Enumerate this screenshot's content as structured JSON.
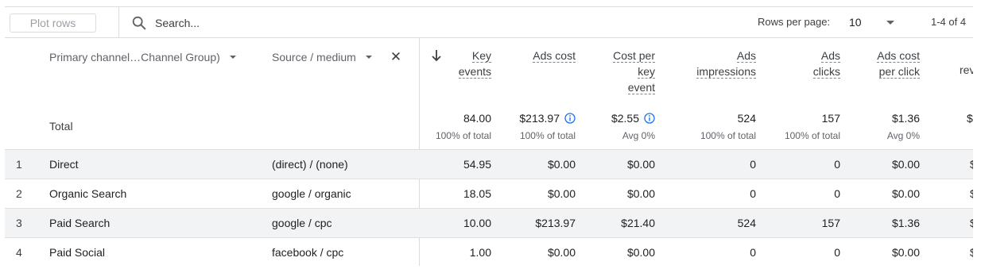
{
  "toolbar": {
    "plot_rows_label": "Plot rows",
    "search_placeholder": "Search...",
    "rows_per_page_label": "Rows per page:",
    "rows_per_page_value": "10",
    "pagination": "1-4 of 4"
  },
  "dimensions": {
    "primary": "Primary channel…Channel Group)",
    "secondary": "Source / medium"
  },
  "metrics": [
    {
      "label_lines": [
        "Key",
        "events"
      ],
      "total": "84.00",
      "total_sub": "100% of total",
      "info": false
    },
    {
      "label_lines": [
        "Ads cost"
      ],
      "total": "$213.97",
      "total_sub": "100% of total",
      "info": true
    },
    {
      "label_lines": [
        "Cost per",
        "key",
        "event"
      ],
      "total": "$2.55",
      "total_sub": "Avg 0%",
      "info": true
    },
    {
      "label_lines": [
        "Ads",
        "impressions"
      ],
      "total": "524",
      "total_sub": "100% of total",
      "info": false
    },
    {
      "label_lines": [
        "Ads",
        "clicks"
      ],
      "total": "157",
      "total_sub": "100% of total",
      "info": false
    },
    {
      "label_lines": [
        "Ads cost",
        "per click"
      ],
      "total": "$1.36",
      "total_sub": "Avg 0%",
      "info": false
    }
  ],
  "cut_column": {
    "label": "rev",
    "total": "$",
    "cell": "$"
  },
  "total_label": "Total",
  "rows": [
    {
      "rank": "1",
      "channel": "Direct",
      "source": "(direct) / (none)",
      "values": [
        "54.95",
        "$0.00",
        "$0.00",
        "0",
        "0",
        "$0.00"
      ]
    },
    {
      "rank": "2",
      "channel": "Organic Search",
      "source": "google / organic",
      "values": [
        "18.05",
        "$0.00",
        "$0.00",
        "0",
        "0",
        "$0.00"
      ]
    },
    {
      "rank": "3",
      "channel": "Paid Search",
      "source": "google / cpc",
      "values": [
        "10.00",
        "$213.97",
        "$21.40",
        "524",
        "157",
        "$1.36"
      ]
    },
    {
      "rank": "4",
      "channel": "Paid Social",
      "source": "facebook / cpc",
      "values": [
        "1.00",
        "$0.00",
        "$0.00",
        "0",
        "0",
        "$0.00"
      ]
    }
  ],
  "colors": {
    "info_icon": "#1a73e8",
    "shaded_row": "#f1f3f4",
    "divider": "#dadce0"
  },
  "icons": {
    "search": "search-icon",
    "sort": "arrow-down-icon",
    "remove": "close-icon",
    "info": "info-icon",
    "dropdown": "caret-down-icon"
  }
}
